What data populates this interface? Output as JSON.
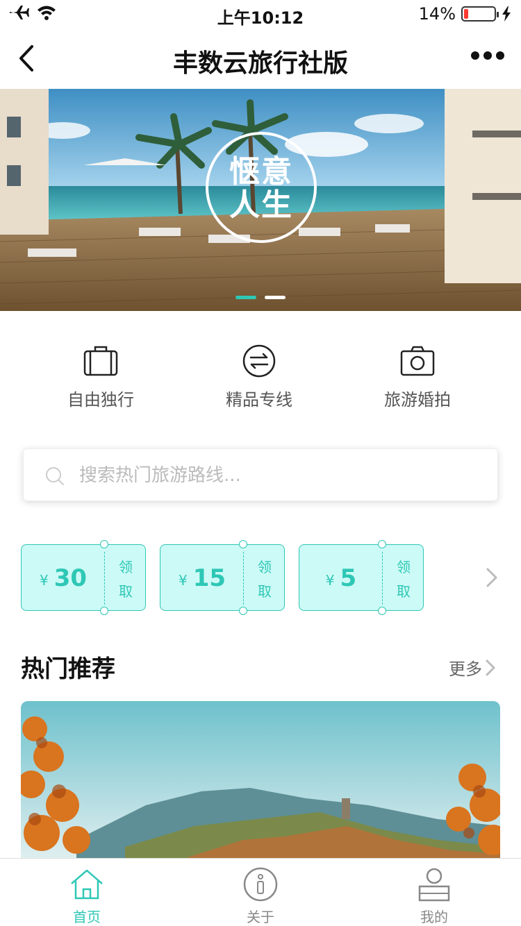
{
  "status_bar": {
    "time": "上午10:12",
    "battery_percent": "14%",
    "battery_level": 0.14,
    "icons": [
      "airplane-icon",
      "wifi-icon",
      "battery-icon",
      "charging-icon"
    ]
  },
  "nav": {
    "title": "丰数云旅行社版",
    "back_icon": "chevron-left-icon",
    "more_icon": "more-dots-icon"
  },
  "banner": {
    "badge_text_line1": "惬意",
    "badge_text_line2": "人生",
    "slides": 2,
    "active_slide": 1
  },
  "categories": [
    {
      "label": "自由独行",
      "icon": "suitcase-icon"
    },
    {
      "label": "精品专线",
      "icon": "exchange-arrows-icon"
    },
    {
      "label": "旅游婚拍",
      "icon": "camera-icon"
    }
  ],
  "search": {
    "placeholder": "搜索热门旅游路线...",
    "value": ""
  },
  "coupons": [
    {
      "currency": "¥",
      "amount": "30",
      "claim_top": "领",
      "claim_bottom": "取"
    },
    {
      "currency": "¥",
      "amount": "15",
      "claim_top": "领",
      "claim_bottom": "取"
    },
    {
      "currency": "¥",
      "amount": "5",
      "claim_top": "领",
      "claim_bottom": "取"
    }
  ],
  "recommend": {
    "title": "热门推荐",
    "more_label": "更多"
  },
  "tabs": [
    {
      "label": "首页",
      "icon": "home-icon",
      "active": true
    },
    {
      "label": "关于",
      "icon": "info-icon",
      "active": false
    },
    {
      "label": "我的",
      "icon": "user-icon",
      "active": false
    }
  ],
  "colors": {
    "accent": "#2ec7b5",
    "coupon_bg": "#ccfaf6",
    "battery_low": "#ff3b30"
  }
}
